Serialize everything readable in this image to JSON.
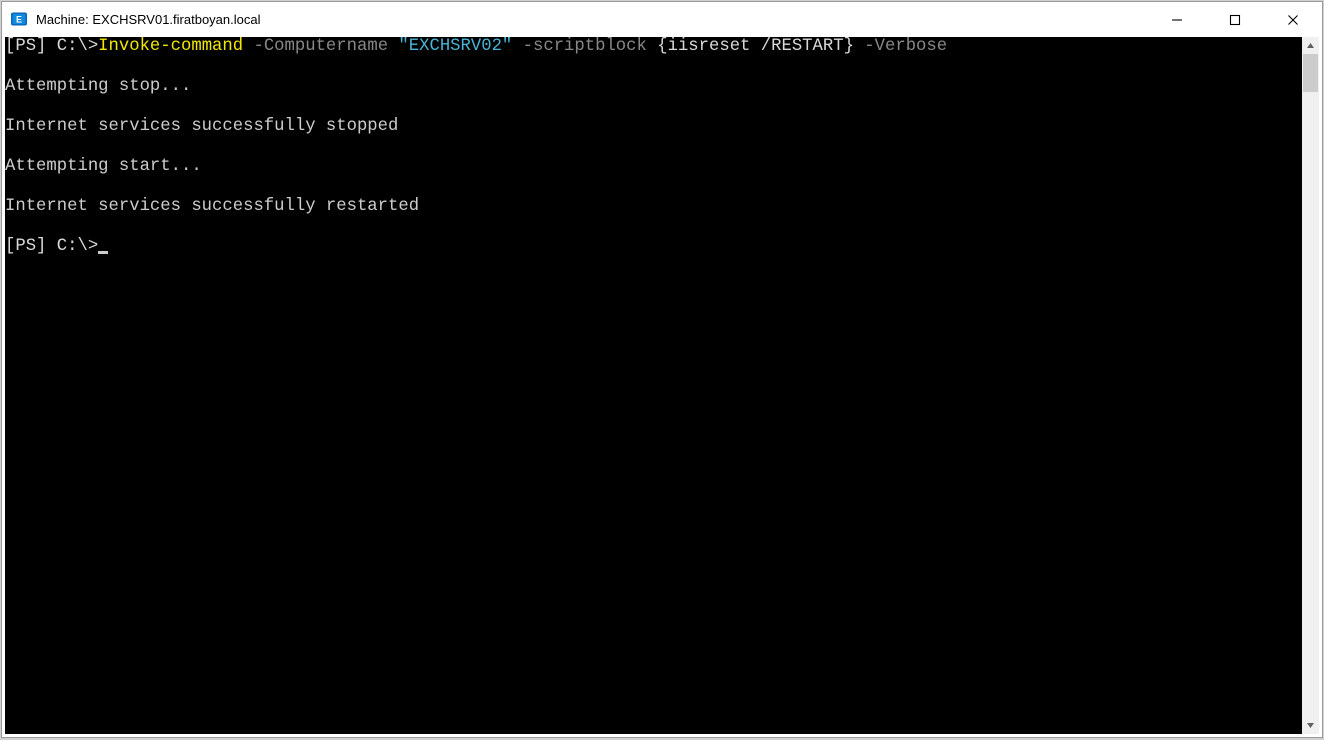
{
  "window": {
    "title": "Machine: EXCHSRV01.firatboyan.local"
  },
  "terminal": {
    "line1": {
      "prompt": "[PS] C:\\>",
      "cmd_yellow": "Invoke-command",
      "sp1": " ",
      "p_computername": "-Computername",
      "sp2": " ",
      "str_target": "\"EXCHSRV02\"",
      "sp3": " ",
      "p_scriptblock": "-scriptblock",
      "sp4": " ",
      "brace_open": "{",
      "sb_body": "iisreset /RESTART",
      "brace_close": "}",
      "sp5": " ",
      "p_verbose": "-Verbose"
    },
    "out1": "Attempting stop...",
    "out2": "Internet services successfully stopped",
    "out3": "Attempting start...",
    "out4": "Internet services successfully restarted",
    "prompt2": "[PS] C:\\>"
  }
}
